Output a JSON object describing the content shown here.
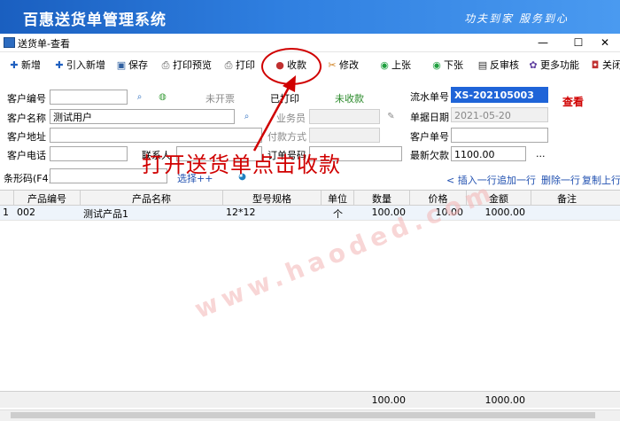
{
  "banner": {
    "title": "百惠送货单管理系统",
    "slogan": "功夫到家  服务到心"
  },
  "window": {
    "title": "送货单-查看",
    "minimize": "—",
    "maximize": "☐",
    "close": "✕"
  },
  "toolbar": {
    "new": "新增",
    "import_new": "引入新增",
    "save": "保存",
    "print_preview": "打印预览",
    "print": "打印",
    "collect": "收款",
    "edit": "修改",
    "prev": "上张",
    "next": "下张",
    "unapprove": "反审核",
    "more": "更多功能",
    "close": "关闭"
  },
  "form": {
    "customer_code_label": "客户编号",
    "customer_code": "",
    "not_invoiced": "未开票",
    "printed": "已打印",
    "not_collected": "未收款",
    "serial_label": "流水单号",
    "serial_no": "XS-202105003",
    "status_view": "查看",
    "customer_name_label": "客户名称",
    "customer_name": "测试用户",
    "salesman_label": "业务员",
    "salesman": "",
    "doc_date_label": "单据日期",
    "doc_date": "2021-05-20",
    "customer_addr_label": "客户地址",
    "customer_addr": "",
    "pay_method_label": "付款方式",
    "pay_method": "",
    "customer_order_label": "客户单号",
    "customer_order": "",
    "customer_phone_label": "客户电话",
    "customer_phone": "",
    "contact_label": "联系人",
    "contact": "",
    "order_no_label": "订单号码",
    "order_no": "",
    "latest_debt_label": "最新欠款",
    "latest_debt": "1100.00",
    "more_btn": "...",
    "barcode_label": "条形码(F4)",
    "barcode": "",
    "select": "选择++",
    "insert_row": "< 插入一行",
    "append_row": "追加一行",
    "delete_row": "删除一行",
    "copy_prev": "复制上行"
  },
  "table": {
    "headers": [
      "产品编号",
      "产品名称",
      "型号规格",
      "单位",
      "数量",
      "价格",
      "金额",
      "备注"
    ],
    "rows": [
      {
        "idx": "1",
        "code": "002",
        "name": "测试产品1",
        "spec": "12*12",
        "unit": "个",
        "qty": "100.00",
        "price": "10.00",
        "amount": "1000.00",
        "note": ""
      }
    ],
    "footer": {
      "qty": "100.00",
      "amount": "1000.00"
    }
  },
  "annotation": {
    "text": "打开送货单点击收款"
  },
  "watermark": "www.haoded.com"
}
